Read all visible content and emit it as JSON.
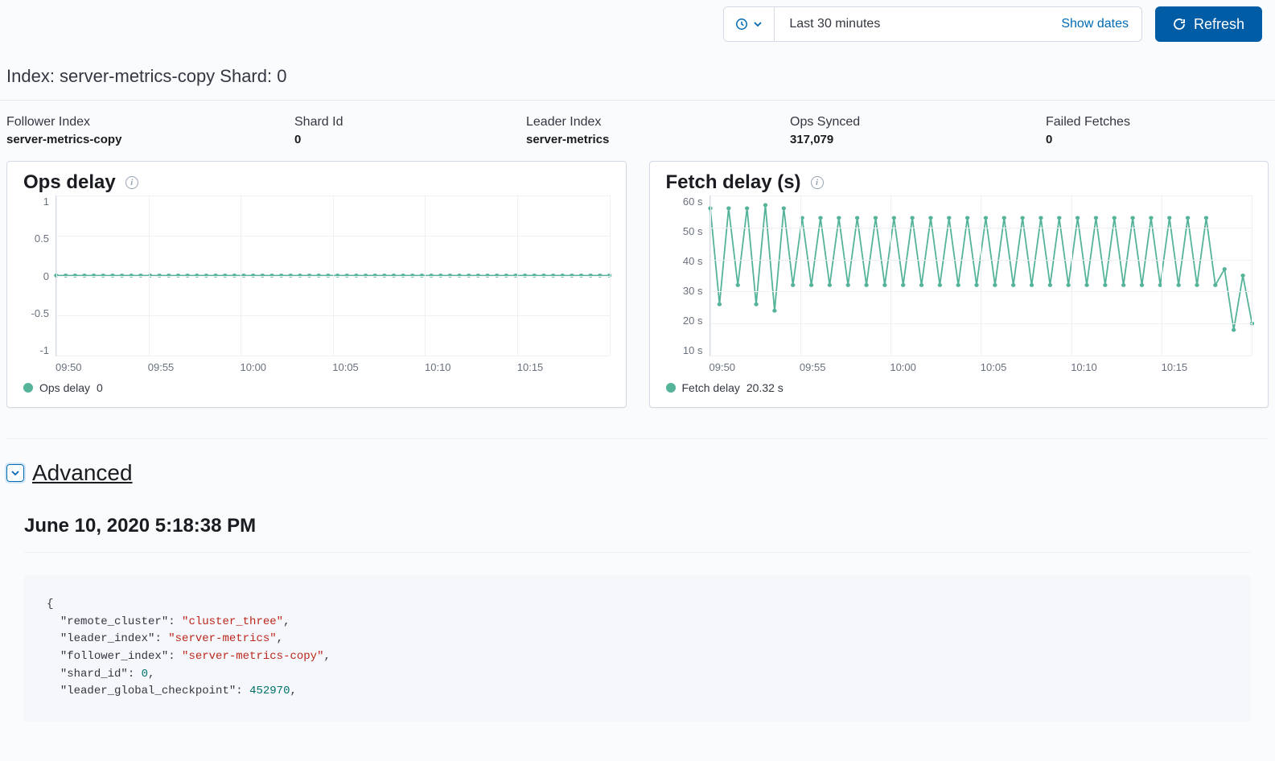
{
  "topbar": {
    "range_text": "Last 30 minutes",
    "show_dates": "Show dates",
    "refresh_label": "Refresh"
  },
  "page_title": "Index: server-metrics-copy Shard: 0",
  "stats": {
    "follower_index": {
      "label": "Follower Index",
      "value": "server-metrics-copy"
    },
    "shard_id": {
      "label": "Shard Id",
      "value": "0"
    },
    "leader_index": {
      "label": "Leader Index",
      "value": "server-metrics"
    },
    "ops_synced": {
      "label": "Ops Synced",
      "value": "317,079"
    },
    "failed_fetches": {
      "label": "Failed Fetches",
      "value": "0"
    }
  },
  "charts": {
    "ops_delay": {
      "title": "Ops delay",
      "legend_name": "Ops delay",
      "legend_value": "0",
      "y_ticks": [
        "1",
        "0.5",
        "0",
        "-0.5",
        "-1"
      ],
      "x_ticks": [
        "09:50",
        "09:55",
        "10:00",
        "10:05",
        "10:10",
        "10:15"
      ]
    },
    "fetch_delay": {
      "title": "Fetch delay (s)",
      "legend_name": "Fetch delay",
      "legend_value": "20.32 s",
      "y_ticks": [
        "60 s",
        "50 s",
        "40 s",
        "30 s",
        "20 s",
        "10 s"
      ],
      "x_ticks": [
        "09:50",
        "09:55",
        "10:00",
        "10:05",
        "10:10",
        "10:15"
      ]
    }
  },
  "chart_data": [
    {
      "type": "line",
      "title": "Ops delay",
      "xlabel": "",
      "ylabel": "",
      "ylim": [
        -1,
        1
      ],
      "x_tick_labels": [
        "09:50",
        "09:55",
        "10:00",
        "10:05",
        "10:10",
        "10:15"
      ],
      "series": [
        {
          "name": "Ops delay",
          "values": [
            0,
            0,
            0,
            0,
            0,
            0,
            0,
            0,
            0,
            0,
            0,
            0,
            0,
            0,
            0,
            0,
            0,
            0,
            0,
            0,
            0,
            0,
            0,
            0,
            0,
            0,
            0,
            0,
            0,
            0,
            0,
            0,
            0,
            0,
            0,
            0,
            0,
            0,
            0,
            0,
            0,
            0,
            0,
            0,
            0,
            0,
            0,
            0,
            0,
            0,
            0,
            0,
            0,
            0,
            0,
            0,
            0,
            0,
            0,
            0
          ]
        }
      ]
    },
    {
      "type": "line",
      "title": "Fetch delay (s)",
      "xlabel": "",
      "ylabel": "",
      "ylim": [
        10,
        60
      ],
      "x_tick_labels": [
        "09:50",
        "09:55",
        "10:00",
        "10:05",
        "10:10",
        "10:15"
      ],
      "series": [
        {
          "name": "Fetch delay",
          "values": [
            56,
            26,
            56,
            32,
            56,
            26,
            57,
            24,
            56,
            32,
            53,
            32,
            53,
            32,
            53,
            32,
            53,
            32,
            53,
            32,
            53,
            32,
            53,
            32,
            53,
            32,
            53,
            32,
            53,
            32,
            53,
            32,
            53,
            32,
            53,
            32,
            53,
            32,
            53,
            32,
            53,
            32,
            53,
            32,
            53,
            32,
            53,
            32,
            53,
            32,
            53,
            32,
            53,
            32,
            53,
            32,
            37,
            18,
            35,
            20
          ]
        }
      ]
    }
  ],
  "advanced": {
    "toggle_label": "Advanced",
    "timestamp": "June 10, 2020 5:18:38 PM",
    "json": {
      "remote_cluster": "cluster_three",
      "leader_index": "server-metrics",
      "follower_index": "server-metrics-copy",
      "shard_id": 0,
      "leader_global_checkpoint": 452970
    }
  }
}
